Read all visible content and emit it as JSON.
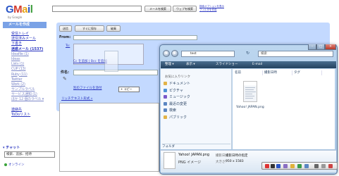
{
  "gmail": {
    "logo": {
      "g": "G",
      "m": "M",
      "a": "a",
      "i": "i",
      "l": "l"
    },
    "logo_sub": "by Google",
    "search_button": "メールを検索",
    "web_search_button": "ウェブを検索",
    "search_links": [
      "検索オプションを表示",
      "フィルタを作成"
    ],
    "compose_link": "メールを作成",
    "nav": [
      {
        "label": "受信トレイ",
        "bold": false
      },
      {
        "label": "送信済みメール",
        "bold": false
      },
      {
        "label": "下書き",
        "bold": false
      },
      {
        "label": "迷惑メール (1537)",
        "bold": true
      },
      {
        "label": "Ideafile (1)",
        "blurred": true
      },
      {
        "label": "Ideas",
        "blurred": true
      },
      {
        "label": "Lists (1)",
        "blurred": true
      },
      {
        "label": "CUP (13)",
        "blurred": true
      },
      {
        "label": "Ruby (11)",
        "blurred": true
      },
      {
        "label": "Twitter",
        "blurred": true
      },
      {
        "label": "Work (2)",
        "blurred": true
      },
      {
        "label": "サンプルラベル",
        "blurred": true
      },
      {
        "label": "サービス通知 (1)",
        "blurred": true
      },
      {
        "label": "ほか 12 個のラベル ▾",
        "blurred": true
      },
      {
        "label": "",
        "blurred": false
      },
      {
        "label": "連絡先",
        "bold": false
      },
      {
        "label": "ToDoリスト",
        "bold": false
      }
    ],
    "chat_heading": "▾ チャット",
    "chat_search_placeholder": "検索、追加、招待",
    "status_label": "オンライン",
    "compose_buttons": {
      "send": "送信",
      "save": "すぐに保存",
      "discard": "破棄"
    },
    "from_label": "From:",
    "to_label": "To:",
    "cc_link": "Cc を追加 | Bcc を追加",
    "subject_label": "件名:",
    "attach_link": "別のファイルを添付",
    "copy_tooltip": "+ コピー",
    "rich_text_link": "リッチテキスト形式 »"
  },
  "explorer": {
    "window_buttons": {
      "minimize": "–",
      "maximize": "□",
      "close": "✕"
    },
    "address": "test",
    "search_placeholder": "検索",
    "toolbar": [
      "整理 ▾",
      "表示 ▾",
      "スライドショー",
      "E-mail"
    ],
    "nav_header": "お気に入りリンク",
    "nav_items": [
      {
        "label": "ドキュメント",
        "color": "#e2b347"
      },
      {
        "label": "ピクチャ",
        "color": "#4e93d6"
      },
      {
        "label": "ミュージック",
        "color": "#7a59c9"
      },
      {
        "label": "最近の変更",
        "color": "#5a86c2"
      },
      {
        "label": "検索",
        "color": "#5a86c2"
      },
      {
        "label": "パブリック",
        "color": "#e2b347"
      }
    ],
    "folders_label": "フォルダ",
    "columns": [
      "名前",
      "撮影日時",
      "タグ"
    ],
    "files": [
      {
        "name": "Yahoo! JAPAN.png"
      }
    ],
    "details": {
      "name": "Yahoo! JAPAN.png",
      "type": "PNG イメージ",
      "label1": "撮影日:",
      "value1": "撮影日時の指定",
      "label2": "大きさ:",
      "value2": "950 x 1583"
    }
  },
  "colors": {
    "gmail_blue": "#c3d9ff",
    "link": "#2a35c0",
    "vista_toolbar": "#23425f"
  }
}
